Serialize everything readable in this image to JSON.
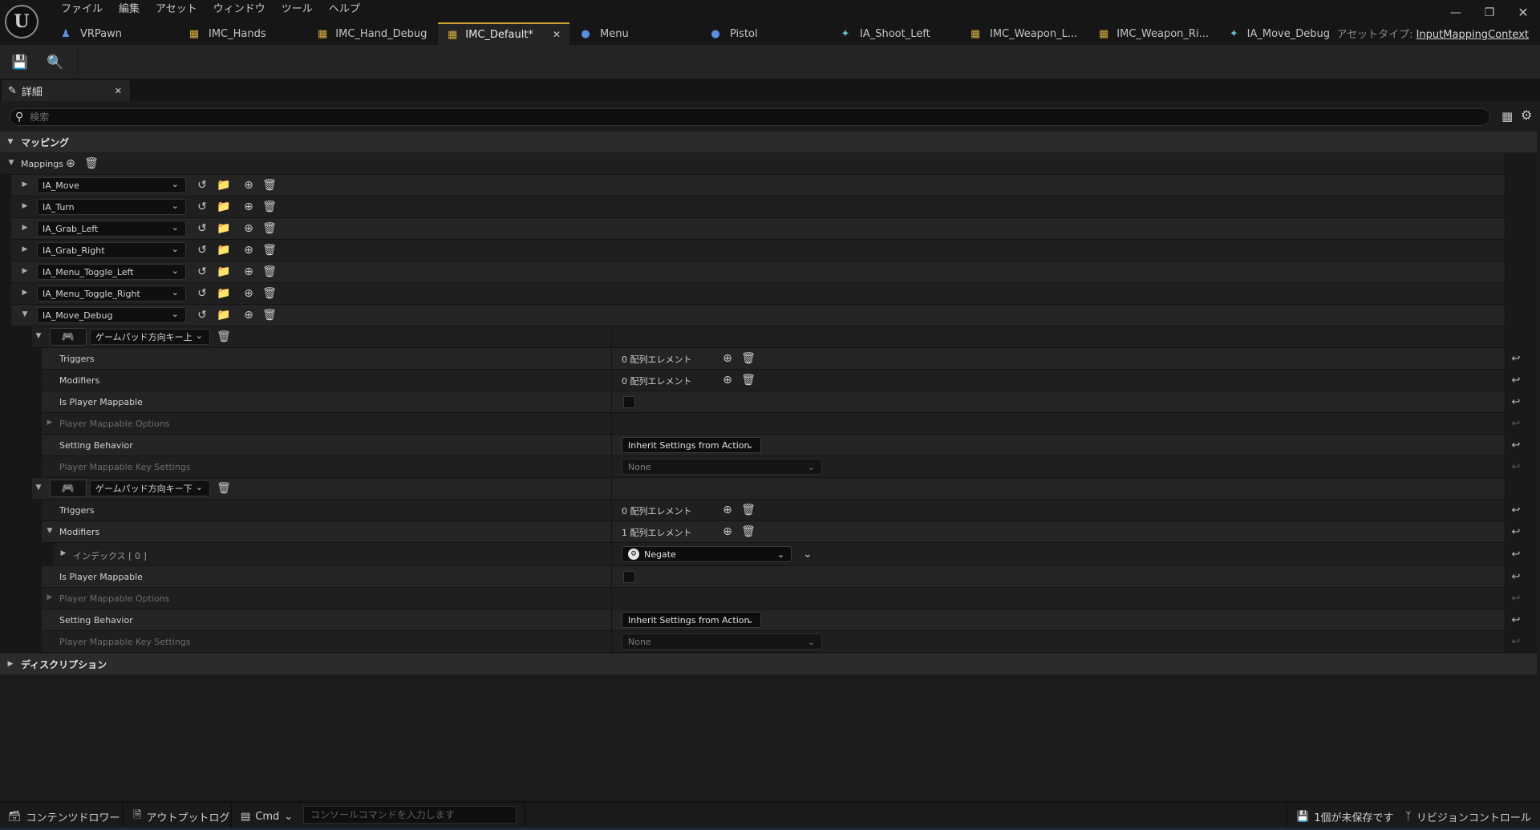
{
  "menu": [
    "ファイル",
    "編集",
    "アセット",
    "ウィンドウ",
    "ツール",
    "ヘルプ"
  ],
  "tabs": [
    {
      "label": "VRPawn",
      "icon": "pawn-icon",
      "color": "#5a8fe0"
    },
    {
      "label": "IMC_Hands",
      "icon": "input-mapping-icon",
      "color": "#d4b040"
    },
    {
      "label": "IMC_Hand_Debug",
      "icon": "input-mapping-icon",
      "color": "#d4b040"
    },
    {
      "label": "IMC_Default*",
      "icon": "input-mapping-icon",
      "color": "#d4b040",
      "active": true
    },
    {
      "label": "Menu",
      "icon": "blueprint-icon",
      "color": "#5a8fe0"
    },
    {
      "label": "Pistol",
      "icon": "blueprint-icon",
      "color": "#5a8fe0"
    },
    {
      "label": "IA_Shoot_Left",
      "icon": "input-action-icon",
      "color": "#68c0d0"
    },
    {
      "label": "IMC_Weapon_L...",
      "icon": "input-mapping-icon",
      "color": "#d4b040"
    },
    {
      "label": "IMC_Weapon_Ri...",
      "icon": "input-mapping-icon",
      "color": "#d4b040"
    },
    {
      "label": "IA_Move_Debug",
      "icon": "input-action-icon",
      "color": "#68c0d0"
    }
  ],
  "asset_type": {
    "label": "アセットタイプ:",
    "value": "InputMappingContext"
  },
  "details_tab": {
    "label": "詳細"
  },
  "search": {
    "placeholder": "検索"
  },
  "category_mapping": "マッピング",
  "category_description": "ディスクリプション",
  "mappings_label": "Mappings",
  "mappings": [
    "IA_Move",
    "IA_Turn",
    "IA_Grab_Left",
    "IA_Grab_Right",
    "IA_Menu_Toggle_Left",
    "IA_Menu_Toggle_Right",
    "IA_Move_Debug"
  ],
  "keys": [
    {
      "key": "ゲームパッド方向キー上",
      "triggers_label": "Triggers",
      "triggers_value": "0 配列エレメント",
      "modifiers_label": "Modifiers",
      "modifiers_value": "0 配列エレメント",
      "player_mappable_label": "Is Player Mappable",
      "player_mappable_options_label": "Player Mappable Options",
      "setting_behavior_label": "Setting Behavior",
      "setting_behavior_value": "Inherit Settings from Action",
      "key_settings_label": "Player Mappable Key Settings",
      "key_settings_value": "None"
    },
    {
      "key": "ゲームパッド方向キー下",
      "triggers_label": "Triggers",
      "triggers_value": "0 配列エレメント",
      "modifiers_label": "Modifiers",
      "modifiers_value": "1 配列エレメント",
      "index_label": "インデックス [ 0 ]",
      "index_value": "Negate",
      "player_mappable_label": "Is Player Mappable",
      "player_mappable_options_label": "Player Mappable Options",
      "setting_behavior_label": "Setting Behavior",
      "setting_behavior_value": "Inherit Settings from Action",
      "key_settings_label": "Player Mappable Key Settings",
      "key_settings_value": "None"
    }
  ],
  "statusbar": {
    "content_drawer": "コンテンツドロワー",
    "output_log": "アウトプットログ",
    "cmd": "Cmd",
    "console_placeholder": "コンソールコマンドを入力します",
    "unsaved": "1個が未保存です",
    "revision_control": "リビジョンコントロール"
  }
}
